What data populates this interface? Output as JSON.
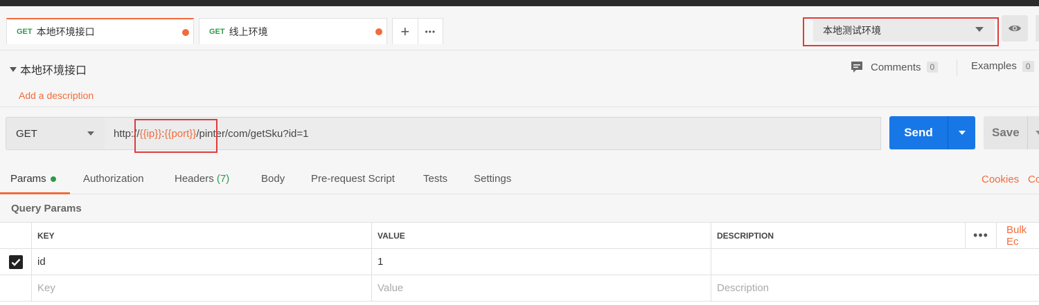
{
  "tabs": [
    {
      "method": "GET",
      "name": "本地环境接口",
      "active": true
    },
    {
      "method": "GET",
      "name": "线上环境",
      "active": false
    }
  ],
  "tab_actions": {
    "add": "+",
    "more": "•••"
  },
  "environment": {
    "selected": "本地测试环境"
  },
  "request": {
    "name": "本地环境接口",
    "add_description": "Add a description",
    "comments_label": "Comments",
    "comments_count": "0",
    "examples_label": "Examples",
    "examples_count": "0",
    "method": "GET",
    "url_prefix": "http://",
    "url_var_ip": "{{ip}}",
    "url_colon": ":",
    "url_var_port": "{{port}}",
    "url_suffix": "/pinter/com/getSku?id=1",
    "send_label": "Send",
    "save_label": "Save"
  },
  "subtabs": {
    "params": "Params",
    "authorization": "Authorization",
    "headers": "Headers",
    "headers_count": "(7)",
    "body": "Body",
    "prerequest": "Pre-request Script",
    "tests": "Tests",
    "settings": "Settings",
    "cookies": "Cookies",
    "code": "Co"
  },
  "query_params": {
    "title": "Query Params",
    "columns": [
      "KEY",
      "VALUE",
      "DESCRIPTION"
    ],
    "more": "•••",
    "bulk_edit": "Bulk Ec",
    "rows": [
      {
        "checked": true,
        "key": "id",
        "value": "1",
        "description": ""
      }
    ],
    "placeholders": {
      "key": "Key",
      "value": "Value",
      "description": "Description"
    }
  },
  "colors": {
    "accent": "#f26b3a",
    "send": "#1877e6",
    "method_green": "#2e9b4b",
    "highlight_red": "#e03a3a"
  }
}
